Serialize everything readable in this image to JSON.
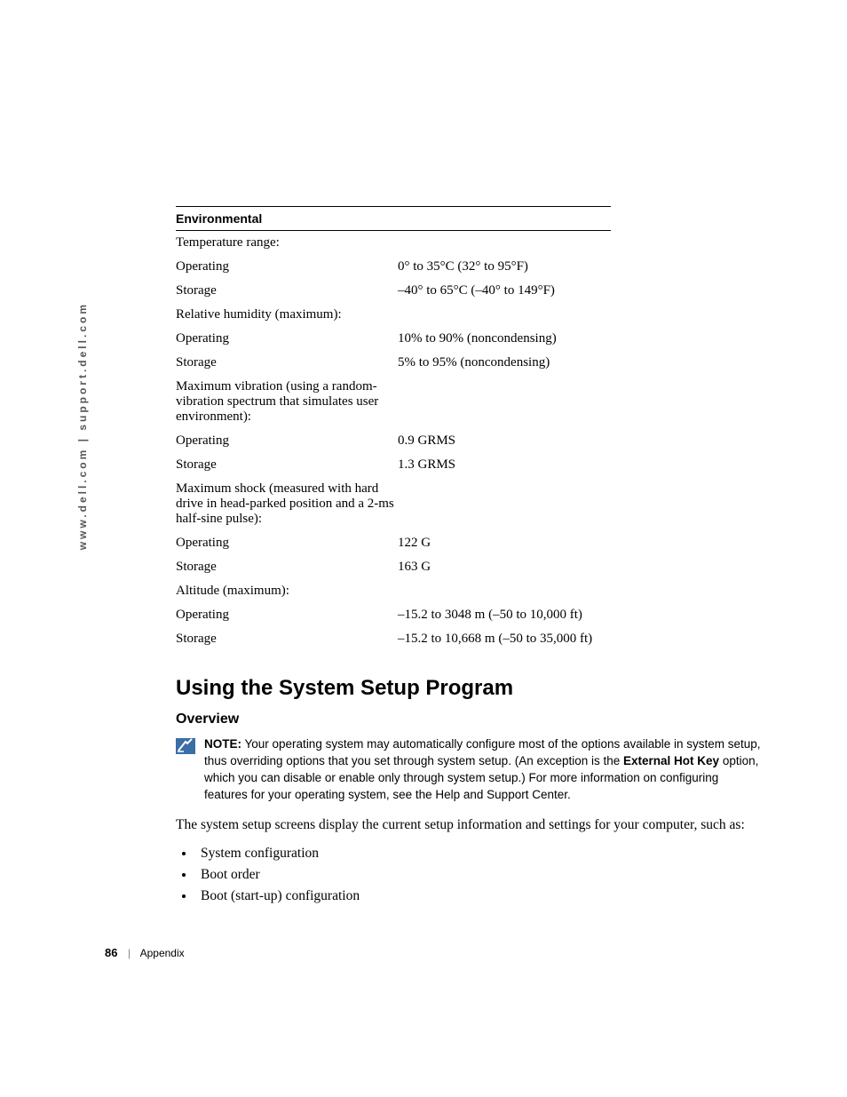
{
  "side_url": "www.dell.com | support.dell.com",
  "table": {
    "header": "Environmental",
    "rows": [
      {
        "label": "Temperature range:",
        "value": "",
        "indent": false
      },
      {
        "label": "Operating",
        "value": "0° to 35°C (32° to 95°F)",
        "indent": true
      },
      {
        "label": "Storage",
        "value": "–40° to 65°C (–40° to 149°F)",
        "indent": true
      },
      {
        "label": "Relative humidity (maximum):",
        "value": "",
        "indent": false
      },
      {
        "label": "Operating",
        "value": "10% to 90% (noncondensing)",
        "indent": true
      },
      {
        "label": "Storage",
        "value": "5% to 95% (noncondensing)",
        "indent": true
      },
      {
        "label": "Maximum vibration (using a random-vibration spectrum that simulates user environment):",
        "value": "",
        "indent": false
      },
      {
        "label": "Operating",
        "value": "0.9 GRMS",
        "indent": true
      },
      {
        "label": "Storage",
        "value": "1.3 GRMS",
        "indent": true
      },
      {
        "label": "Maximum shock (measured with hard drive in head-parked position and a 2-ms half-sine pulse):",
        "value": "",
        "indent": false
      },
      {
        "label": "Operating",
        "value": "122 G",
        "indent": true
      },
      {
        "label": "Storage",
        "value": "163 G",
        "indent": true
      },
      {
        "label": "Altitude (maximum):",
        "value": "",
        "indent": false
      },
      {
        "label": "Operating",
        "value": "–15.2 to 3048 m (–50 to 10,000 ft)",
        "indent": true
      },
      {
        "label": "Storage",
        "value": "–15.2 to 10,668 m (–50 to 35,000 ft)",
        "indent": true
      }
    ]
  },
  "heading": "Using the System Setup Program",
  "subheading": "Overview",
  "note": {
    "label": "NOTE:",
    "text_before": " Your operating system may automatically configure most of the options available in system setup, thus overriding options that you set through system setup. (An exception is the ",
    "bold_inline": "External Hot Key",
    "text_after": " option, which you can disable or enable only through system setup.) For more information on configuring features for your operating system, see the Help and Support Center."
  },
  "paragraph": "The system setup screens display the current setup information and settings for your computer, such as:",
  "bullets": [
    "System configuration",
    "Boot order",
    "Boot (start-up) configuration"
  ],
  "footer": {
    "page": "86",
    "section": "Appendix"
  }
}
